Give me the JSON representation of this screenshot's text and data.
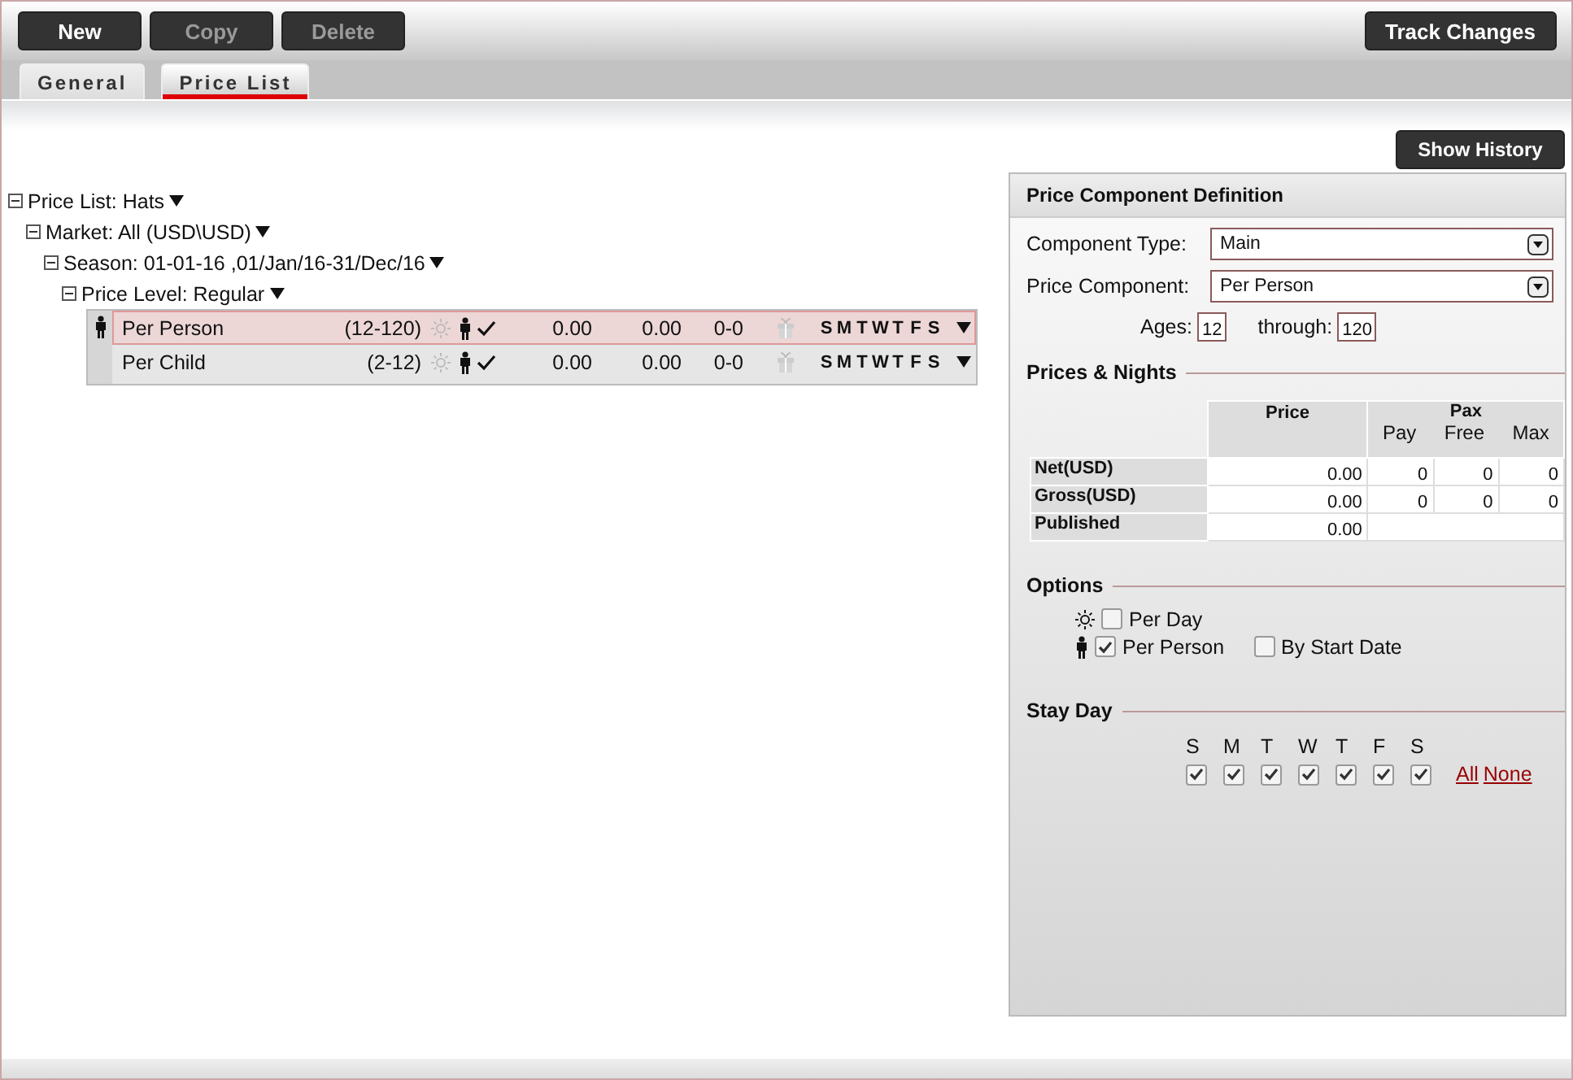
{
  "toolbar": {
    "buttons": [
      {
        "label": "New",
        "disabled": false
      },
      {
        "label": "Copy",
        "disabled": true
      },
      {
        "label": "Delete",
        "disabled": true
      }
    ],
    "track_changes": "Track Changes"
  },
  "tabs": [
    {
      "label": "General",
      "selected": false
    },
    {
      "label": "Price List",
      "selected": true
    }
  ],
  "show_history": "Show History",
  "tree": {
    "label": "Price List: Hats",
    "expanded": true,
    "children": [
      {
        "label": "Market: All (USD\\USD)",
        "expanded": true,
        "children": [
          {
            "label": "Season: 01-01-16 ,01/Jan/16-31/Dec/16",
            "expanded": true,
            "children": [
              {
                "label": "Price Level: Regular",
                "expanded": true
              }
            ]
          }
        ]
      }
    ]
  },
  "components": [
    {
      "name": "Per Person",
      "ages": "(12-120)",
      "net": "0.00",
      "gross": "0.00",
      "nights": "0-0",
      "days": [
        "S",
        "M",
        "T",
        "W",
        "T",
        "F",
        "S"
      ],
      "selected": true
    },
    {
      "name": "Per Child",
      "ages": "(2-12)",
      "net": "0.00",
      "gross": "0.00",
      "nights": "0-0",
      "days": [
        "S",
        "M",
        "T",
        "W",
        "T",
        "F",
        "S"
      ],
      "selected": false
    }
  ],
  "panel": {
    "title": "Price Component Definition",
    "component_type": {
      "label": "Component Type:",
      "value": "Main"
    },
    "price_component": {
      "label": "Price Component:",
      "value": "Per Person"
    },
    "ages": {
      "label": "Ages:",
      "from": "12",
      "through_label": "through:",
      "to": "120"
    },
    "prices_title": "Prices & Nights",
    "table": {
      "price_header": "Price",
      "pax_header": "Pax",
      "pax_columns": [
        "Pay",
        "Free",
        "Max"
      ],
      "rows": [
        {
          "label": "Net(USD)",
          "price": "0.00",
          "pax": [
            "0",
            "0",
            "0"
          ]
        },
        {
          "label": "Gross(USD)",
          "price": "0.00",
          "pax": [
            "0",
            "0",
            "0"
          ]
        },
        {
          "label": "Published",
          "price": "0.00",
          "pax": []
        }
      ]
    },
    "options_title": "Options",
    "options": [
      {
        "label": "Per Day",
        "checked": false
      },
      {
        "label": "Per Person",
        "checked": true
      },
      {
        "label": "By Start Date",
        "checked": false
      }
    ],
    "stay_title": "Stay Day",
    "stay_days": [
      {
        "label": "S",
        "checked": true
      },
      {
        "label": "M",
        "checked": true
      },
      {
        "label": "T",
        "checked": true
      },
      {
        "label": "W",
        "checked": true
      },
      {
        "label": "T",
        "checked": true
      },
      {
        "label": "F",
        "checked": true
      },
      {
        "label": "S",
        "checked": true
      }
    ],
    "links": [
      "All",
      "None"
    ]
  }
}
